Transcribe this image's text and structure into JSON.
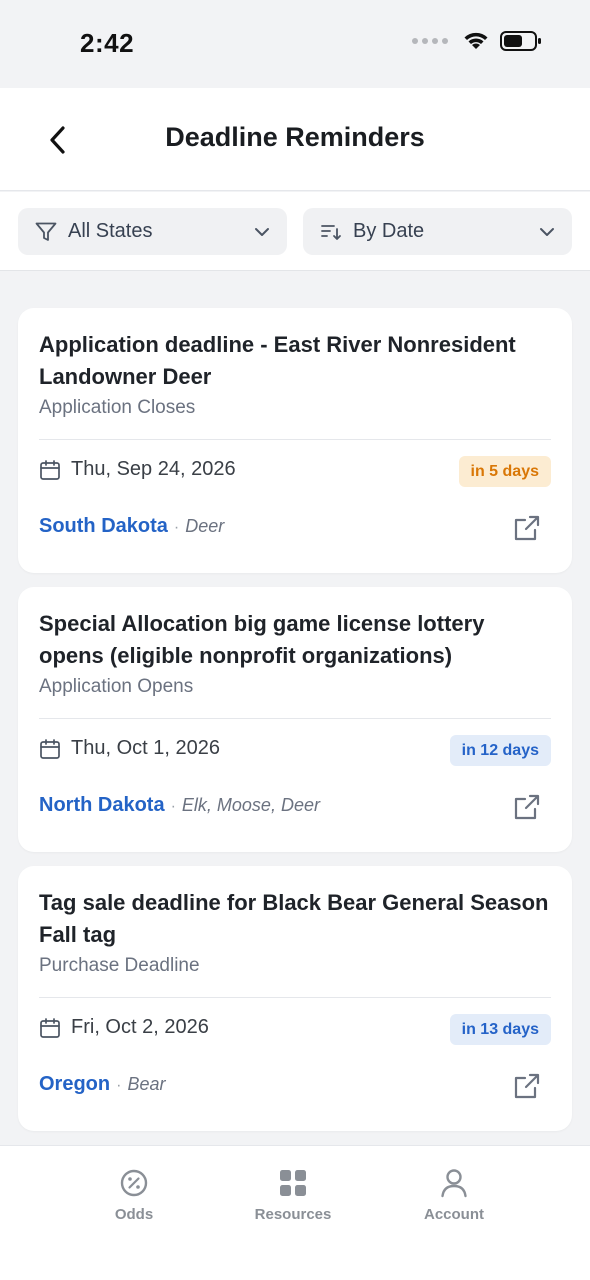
{
  "status_bar": {
    "time": "2:42"
  },
  "header": {
    "title": "Deadline Reminders"
  },
  "filters": {
    "states_label": "All States",
    "sort_label": "By Date"
  },
  "cards": [
    {
      "title": "Application deadline - East River Nonresident Landowner Deer",
      "type": "Application Closes",
      "date": "Thu, Sep 24, 2026",
      "badge": "in 5 days",
      "badge_color": "#d97706",
      "state": "South Dakota",
      "species": "Deer"
    },
    {
      "title": "Special Allocation big game license lottery opens (eligible nonprofit organizations)",
      "type": "Application Opens",
      "date": "Thu, Oct 1, 2026",
      "badge": "in 12 days",
      "badge_color": "#2563c8",
      "state": "North Dakota",
      "species": "Elk, Moose, Deer"
    },
    {
      "title": "Tag sale deadline for Black Bear General Season Fall tag",
      "type": "Purchase Deadline",
      "date": "Fri, Oct 2, 2026",
      "badge": "in 13 days",
      "badge_color": "#2563c8",
      "state": "Oregon",
      "species": "Bear"
    }
  ],
  "meta_separator": "·",
  "tabbar": {
    "odds": "Odds",
    "resources": "Resources",
    "account": "Account"
  },
  "icons": {
    "back": "chevron-left-icon",
    "filter": "funnel-icon",
    "sort": "sort-icon",
    "calendar": "calendar-icon",
    "external": "external-link-icon",
    "odds": "percent-icon",
    "resources": "grid-icon",
    "account": "person-icon"
  },
  "colors": {
    "accent": "#2463c6",
    "background": "#f2f3f5",
    "card": "#ffffff"
  }
}
